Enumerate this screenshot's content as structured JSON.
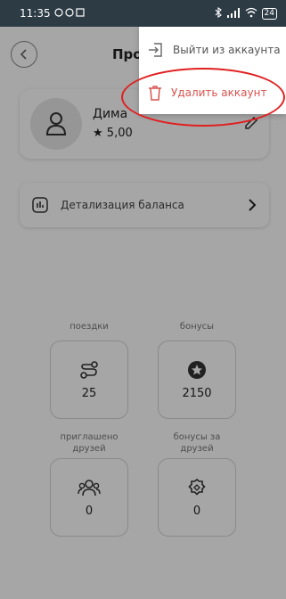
{
  "status_bar": {
    "time": "11:35",
    "battery": "24"
  },
  "header": {
    "title": "Про"
  },
  "profile": {
    "name": "Дима",
    "rating": "5,00"
  },
  "balance": {
    "label": "Детализация баланса"
  },
  "stats": [
    {
      "label": "поездки",
      "value": "25",
      "icon": "route-icon"
    },
    {
      "label": "бонусы",
      "value": "2150",
      "icon": "star-badge-icon"
    },
    {
      "label": "приглашено друзей",
      "value": "0",
      "icon": "users-icon"
    },
    {
      "label": "бонусы за друзей",
      "value": "0",
      "icon": "gift-badge-icon"
    }
  ],
  "menu": {
    "logout_label": "Выйти из аккаунта",
    "delete_label": "Удалить аккаунт"
  },
  "colors": {
    "delete": "#d9534f",
    "highlight": "#e02020",
    "status_bar": "#2d3b45"
  }
}
